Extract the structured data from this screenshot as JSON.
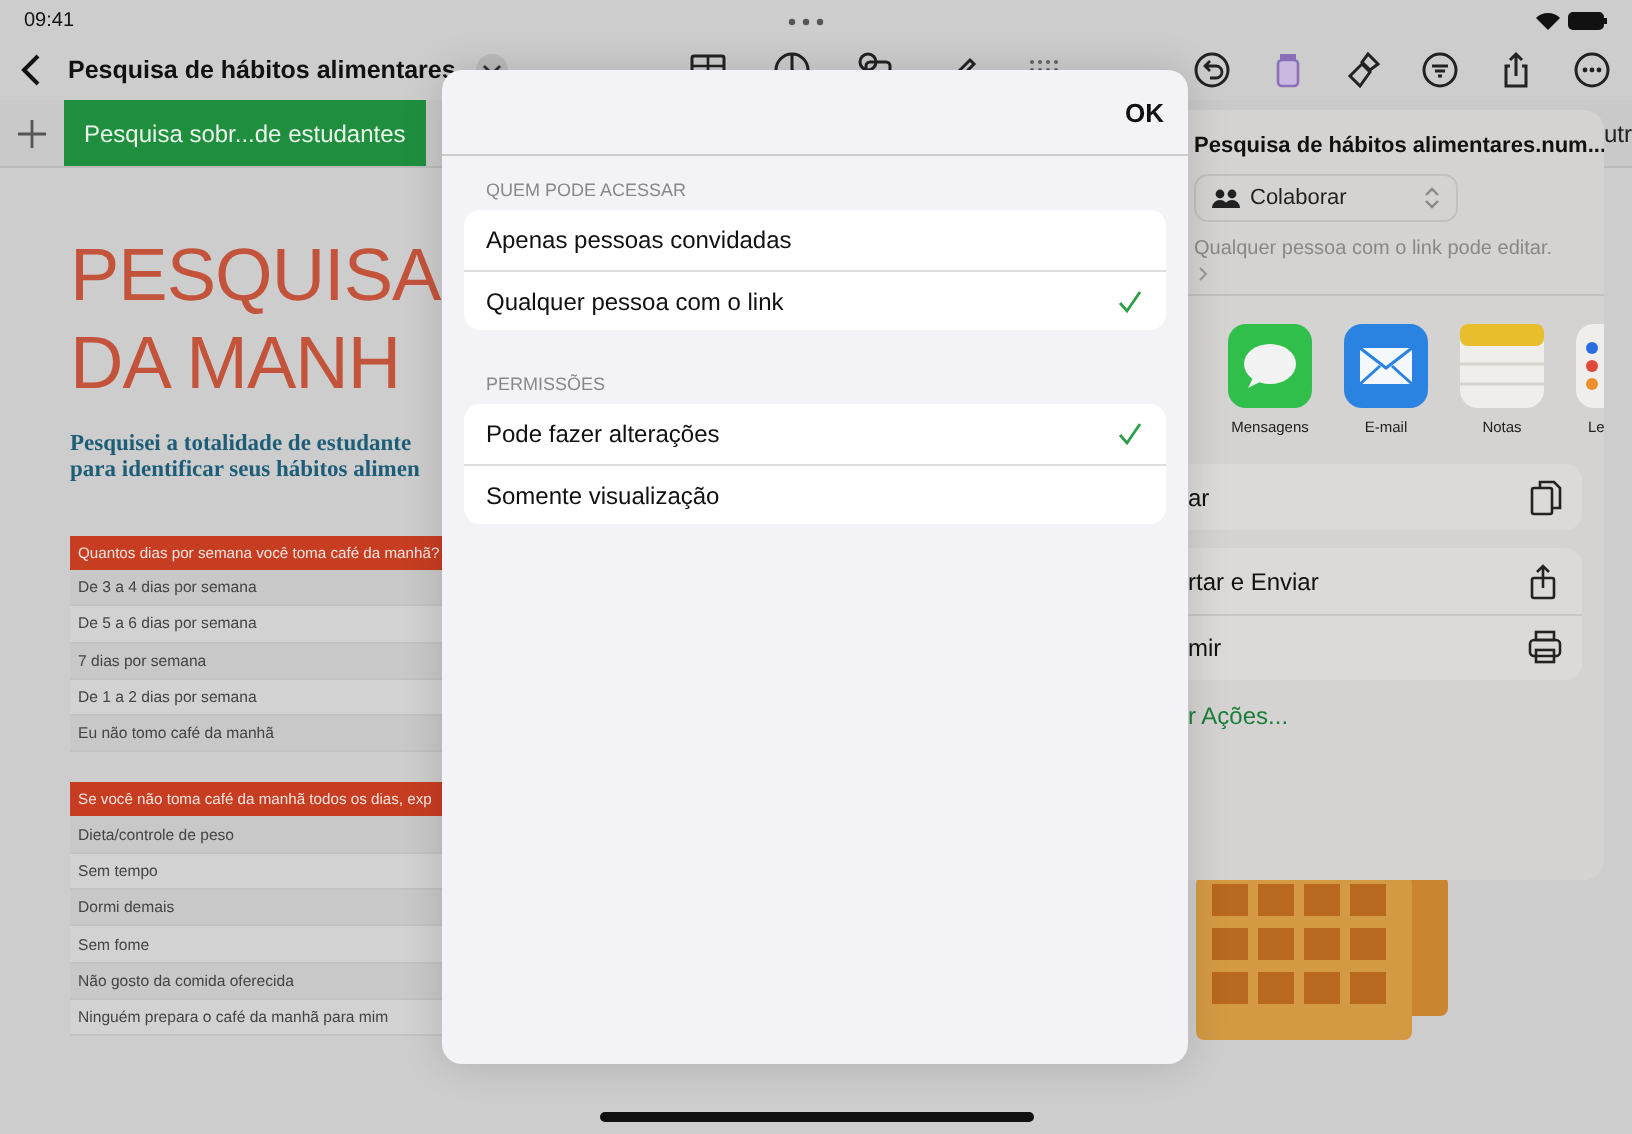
{
  "status_bar": {
    "time": "09:41"
  },
  "toolbar": {
    "title": "Pesquisa de hábitos alimentares"
  },
  "sheet_tabs": [
    {
      "label": "Pesquisa sobr...de estudantes",
      "selected": true
    },
    {
      "label": "utr",
      "selected": false
    }
  ],
  "document": {
    "title_lines": [
      "PESQUISA",
      "DA MANH"
    ],
    "subtitle_lines": [
      "Pesquisei a totalidade de estudante",
      "para identificar seus hábitos alimen"
    ],
    "tables": [
      {
        "header": "Quantos dias por semana você toma café da manhã?",
        "rows": [
          "De 3 a 4 dias por semana",
          "De 5 a 6 dias por semana",
          "7 dias por semana",
          "De 1 a 2 dias por semana",
          "Eu não tomo café da manhã"
        ]
      },
      {
        "header": "Se você não toma café da manhã todos os dias, exp",
        "rows": [
          "Dieta/controle de peso",
          "Sem tempo",
          "Dormi demais",
          "Sem fome",
          "Não gosto da comida oferecida",
          "Ninguém prepara o café da manhã para mim"
        ]
      }
    ]
  },
  "share_popover": {
    "file_name": "Pesquisa de hábitos alimentares.num...",
    "mode": "Colaborar",
    "access_note": "Qualquer pessoa com o link pode editar.",
    "apps": [
      {
        "label": "Mensagens",
        "kind": "messages"
      },
      {
        "label": "E-mail",
        "kind": "mail"
      },
      {
        "label": "Notas",
        "kind": "notes"
      },
      {
        "label": "Le",
        "kind": "reminders"
      }
    ],
    "actions": [
      {
        "label": "ar",
        "kind": "copy"
      },
      {
        "label": "rtar e Enviar",
        "kind": "export"
      },
      {
        "label": "mir",
        "kind": "print"
      }
    ],
    "more_link": "r Ações..."
  },
  "dialog": {
    "done": "OK",
    "sections": [
      {
        "heading": "QUEM PODE ACESSAR",
        "options": [
          {
            "label": "Apenas pessoas convidadas",
            "selected": false
          },
          {
            "label": "Qualquer pessoa com o link",
            "selected": true
          }
        ]
      },
      {
        "heading": "PERMISSÕES",
        "options": [
          {
            "label": "Pode fazer alterações",
            "selected": true
          },
          {
            "label": "Somente visualização",
            "selected": false
          }
        ]
      }
    ]
  }
}
